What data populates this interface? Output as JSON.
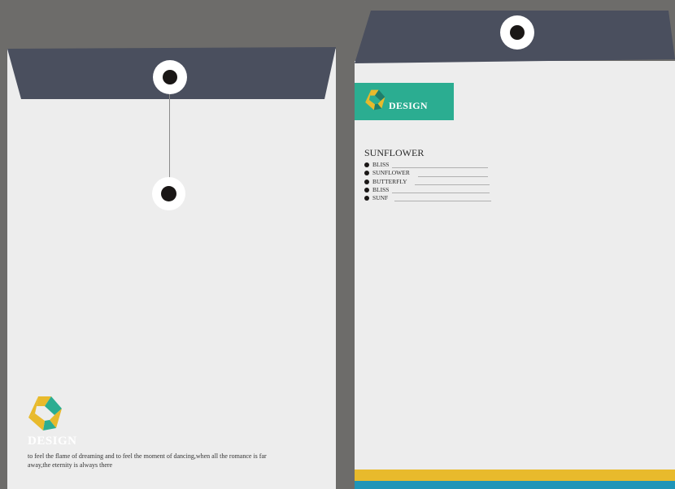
{
  "left_envelope": {
    "brand": "DESIGN",
    "tagline": "to feel the flame of dreaming and to feel the moment of dancing,when all the romance is far away,the eternity is always there"
  },
  "right_envelope": {
    "brand": "DESIGN",
    "list_title": "SUNFLOWER",
    "list_items": [
      "BLISS",
      "SUNFLOWER",
      "BUTTERFLY",
      "BLISS",
      "SUNF"
    ]
  },
  "colors": {
    "background": "#6d6c6a",
    "paper": "#ededed",
    "flap": "#4a4f5e",
    "teal": "#2bad91",
    "yellow": "#e8ba2c",
    "blue_stripe": "#1f95b8"
  },
  "icons": [
    "logo-mark-icon",
    "grommet-icon"
  ]
}
